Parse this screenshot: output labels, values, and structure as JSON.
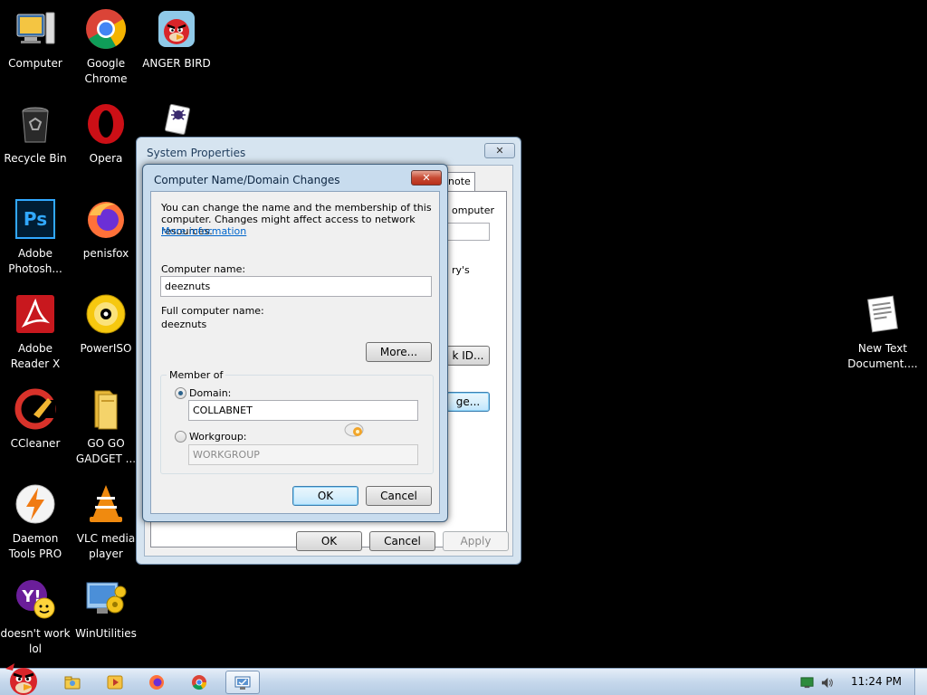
{
  "desktop": {
    "icons": [
      {
        "label": "Computer"
      },
      {
        "label": "Google Chrome"
      },
      {
        "label": "ANGER BIRD"
      },
      {
        "label": "Recycle Bin"
      },
      {
        "label": "Opera"
      },
      {
        "label": "Adobe Photosh..."
      },
      {
        "label": "penisfox"
      },
      {
        "label": "Adobe Reader X"
      },
      {
        "label": "PowerISO"
      },
      {
        "label": "CCleaner"
      },
      {
        "label": "GO GO GADGET ..."
      },
      {
        "label": "Daemon Tools PRO"
      },
      {
        "label": "VLC media player"
      },
      {
        "label": "doesn't work lol"
      },
      {
        "label": "WinUtilities"
      },
      {
        "label": "New Text Document...."
      }
    ]
  },
  "system_properties": {
    "title": "System Properties",
    "close_label": "✕",
    "tab_partial": "note",
    "frag_computer": "omputer",
    "frag_rys": "ry's",
    "frag_network_id": "k ID...",
    "frag_change": "ge...",
    "ok_label": "OK",
    "cancel_label": "Cancel",
    "apply_label": "Apply"
  },
  "name_dialog": {
    "title": "Computer Name/Domain Changes",
    "close_label": "✕",
    "intro_line1": "You can change the name and the membership of this",
    "intro_line2": "computer. Changes might affect access to network resources.",
    "more_info_link": "More information",
    "computer_name_label": "Computer name:",
    "computer_name_value": "deeznuts",
    "full_name_label": "Full computer name:",
    "full_name_value": "deeznuts",
    "more_button": "More...",
    "member_of_label": "Member of",
    "domain_label": "Domain:",
    "domain_value": "COLLABNET",
    "workgroup_label": "Workgroup:",
    "workgroup_value": "WORKGROUP",
    "selected_membership": "domain",
    "ok_label": "OK",
    "cancel_label": "Cancel"
  },
  "taskbar": {
    "items": [
      "angry-bird-start",
      "explorer",
      "media-player",
      "firefox",
      "chrome",
      "system-properties"
    ],
    "clock": "11:24 PM"
  }
}
